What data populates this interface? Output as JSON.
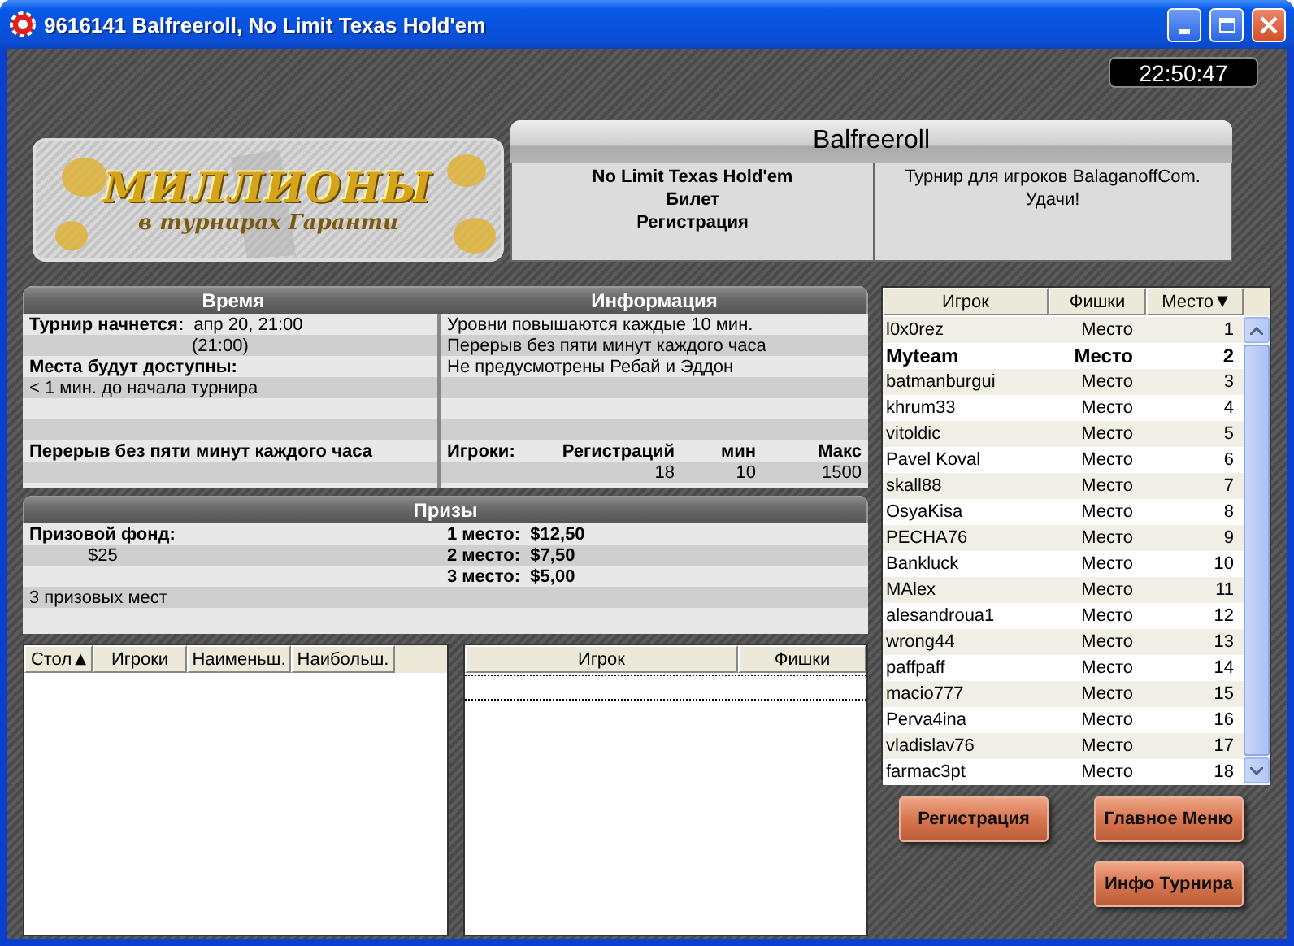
{
  "window": {
    "title": "9616141 Balfreeroll, No Limit Texas Hold'em"
  },
  "clock": "22:50:47",
  "logo": {
    "title": "МИЛЛИОНЫ",
    "subtitle": "в турнирах Гаранти"
  },
  "tournament": {
    "name": "Balfreeroll",
    "details": [
      "No Limit Texas Hold'em",
      "Билет",
      "Регистрация"
    ],
    "description": [
      "Турнир для игроков BalaganoffCom.",
      "Удачи!"
    ]
  },
  "time_panel": {
    "title": "Время",
    "rows": [
      {
        "kind": "label_value",
        "label": "Турнир начнется:",
        "value": "апр 20, 21:00"
      },
      {
        "kind": "value",
        "value": "(21:00)"
      },
      {
        "kind": "label",
        "label": "Места будут доступны:"
      },
      {
        "kind": "value",
        "value": "< 1 мин.  до начала турнира"
      },
      {
        "kind": "blank"
      },
      {
        "kind": "blank"
      },
      {
        "kind": "label",
        "label": "Перерыв без пяти минут каждого часа"
      },
      {
        "kind": "blank"
      }
    ]
  },
  "info_panel": {
    "title": "Информация",
    "notes": [
      "Уровни повышаются каждые 10 мин.",
      "Перерыв без пяти минут каждого часа",
      "Не предусмотрены Ребай и Эддон"
    ],
    "players": {
      "label": "Игроки:",
      "columns": [
        {
          "heading": "Регистраций",
          "value": "18"
        },
        {
          "heading": "мин",
          "value": "10"
        },
        {
          "heading": "Макс",
          "value": "1500"
        }
      ]
    }
  },
  "prizes": {
    "title": "Призы",
    "fund_label": "Призовой фонд:",
    "fund": "$25",
    "places": [
      {
        "label": "1 место:",
        "amount": "$12,50"
      },
      {
        "label": "2 место:",
        "amount": "$7,50"
      },
      {
        "label": "3 место:",
        "amount": "$5,00"
      }
    ],
    "count": "3 призовых мест"
  },
  "tables_list": {
    "columns": [
      {
        "label": "Стол",
        "sort_arrow": "▲"
      },
      {
        "label": "Игроки"
      },
      {
        "label": "Наименьш."
      },
      {
        "label": "Наибольш."
      }
    ]
  },
  "table_players": {
    "columns": [
      {
        "label": "Игрок"
      },
      {
        "label": "Фишки"
      }
    ]
  },
  "players": {
    "columns": [
      {
        "label": "Игрок"
      },
      {
        "label": "Фишки"
      },
      {
        "label": "Место",
        "sort_arrow": "▼"
      }
    ],
    "rows": [
      {
        "name": "l0x0rez",
        "chips": "Место",
        "place": "1",
        "current": false
      },
      {
        "name": "Myteam",
        "chips": "Место",
        "place": "2",
        "current": true
      },
      {
        "name": "batmanburgui",
        "chips": "Место",
        "place": "3",
        "current": false
      },
      {
        "name": "khrum33",
        "chips": "Место",
        "place": "4",
        "current": false
      },
      {
        "name": "vitoldic",
        "chips": "Место",
        "place": "5",
        "current": false
      },
      {
        "name": "Pavel Koval",
        "chips": "Место",
        "place": "6",
        "current": false
      },
      {
        "name": "skall88",
        "chips": "Место",
        "place": "7",
        "current": false
      },
      {
        "name": "OsyaKisa",
        "chips": "Место",
        "place": "8",
        "current": false
      },
      {
        "name": "PECHA76",
        "chips": "Место",
        "place": "9",
        "current": false
      },
      {
        "name": "Bankluck",
        "chips": "Место",
        "place": "10",
        "current": false
      },
      {
        "name": "MAlex",
        "chips": "Место",
        "place": "11",
        "current": false
      },
      {
        "name": "alesandroua1",
        "chips": "Место",
        "place": "12",
        "current": false
      },
      {
        "name": "wrong44",
        "chips": "Место",
        "place": "13",
        "current": false
      },
      {
        "name": "paffpaff",
        "chips": "Место",
        "place": "14",
        "current": false
      },
      {
        "name": "macio777",
        "chips": "Место",
        "place": "15",
        "current": false
      },
      {
        "name": "Perva4ina",
        "chips": "Место",
        "place": "16",
        "current": false
      },
      {
        "name": "vladislav76",
        "chips": "Место",
        "place": "17",
        "current": false
      },
      {
        "name": "farmac3pt",
        "chips": "Место",
        "place": "18",
        "current": false
      }
    ]
  },
  "buttons": [
    "Регистрация",
    "Главное Меню",
    "Инфо Турнира"
  ]
}
